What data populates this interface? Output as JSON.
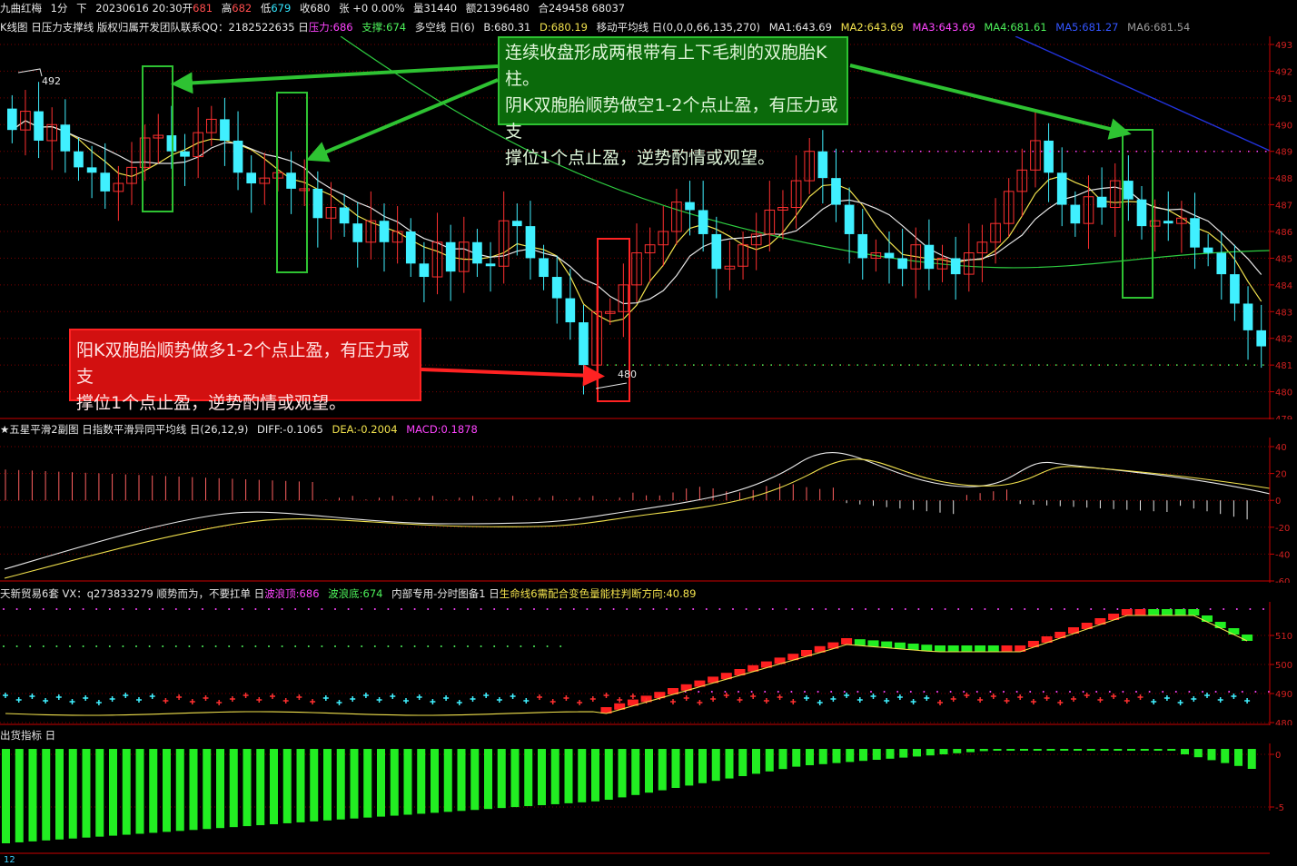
{
  "header": {
    "name": "九曲红梅",
    "period": "1分",
    "session": "下",
    "datetime": "20230616 20:30",
    "open_label": "开",
    "open": "681",
    "high_label": "高",
    "high": "682",
    "low_label": "低",
    "low": "679",
    "close_label": "收",
    "close": "680",
    "change": "张 +0 0.00%",
    "volume": "量31440",
    "amount": "额21396480",
    "position": "合249458 68037"
  },
  "main_panel": {
    "title": "K线图 日压力支撑线 版权归属开发团队联系QQ：2182522635 日",
    "pressure": "压力:686",
    "support": "支撑:674",
    "long_short": "多空线 日(6)",
    "b_value": "B:680.31",
    "d_value": "D:680.19",
    "ma_title": "移动平均线 日(0,0,0,66,135,270)",
    "ma1": "MA1:643.69",
    "ma2": "MA2:643.69",
    "ma3": "MA3:643.69",
    "ma4": "MA4:681.61",
    "ma5": "MA5:681.27",
    "ma6": "MA6:681.54",
    "high_mark": "492",
    "low_mark": "480",
    "yticks": [
      "493",
      "492",
      "491",
      "490",
      "489",
      "488",
      "487",
      "486",
      "485",
      "484",
      "483",
      "482",
      "481",
      "480",
      "479"
    ]
  },
  "annotations": {
    "green_box": [
      "连续收盘形成两根带有上下毛刺的双胞胎K柱。",
      "阴K双胞胎顺势做空1-2个点止盈，有压力或支",
      "撑位1个点止盈，逆势酌情或观望。"
    ],
    "red_box": [
      "阳K双胞胎顺势做多1-2个点止盈，有压力或支",
      "撑位1个点止盈，逆势酌情或观望。"
    ]
  },
  "macd_panel": {
    "title": "★五星平滑2副图 日指数平滑异同平均线 日(26,12,9)",
    "diff": "DIFF:-0.1065",
    "dea": "DEA:-0.2004",
    "macd": "MACD:0.1878",
    "yticks": [
      "40",
      "20",
      "0",
      "-20",
      "-40",
      "-60"
    ]
  },
  "trade_panel": {
    "title": "天新贸易6套 VX：q273833279   顺势而为，不要扛单 日",
    "wave_top": "波浪顶:686",
    "wave_bottom": "波浪底:674",
    "internal": "内部专用-分时图备1 日",
    "lifeline": "生命线6需配合变色量能柱判断方向:40.89",
    "yticks": [
      "510",
      "500",
      "490",
      "480"
    ]
  },
  "volume_panel": {
    "title": "出货指标 日",
    "yticks": [
      "0",
      "-5"
    ],
    "bottom_label": "12"
  },
  "colors": {
    "bull": "#ff3030",
    "bear": "#40f0ff",
    "green_bar": "#22ee22",
    "grid": "#7a0000",
    "axis": "#cc0000"
  }
}
